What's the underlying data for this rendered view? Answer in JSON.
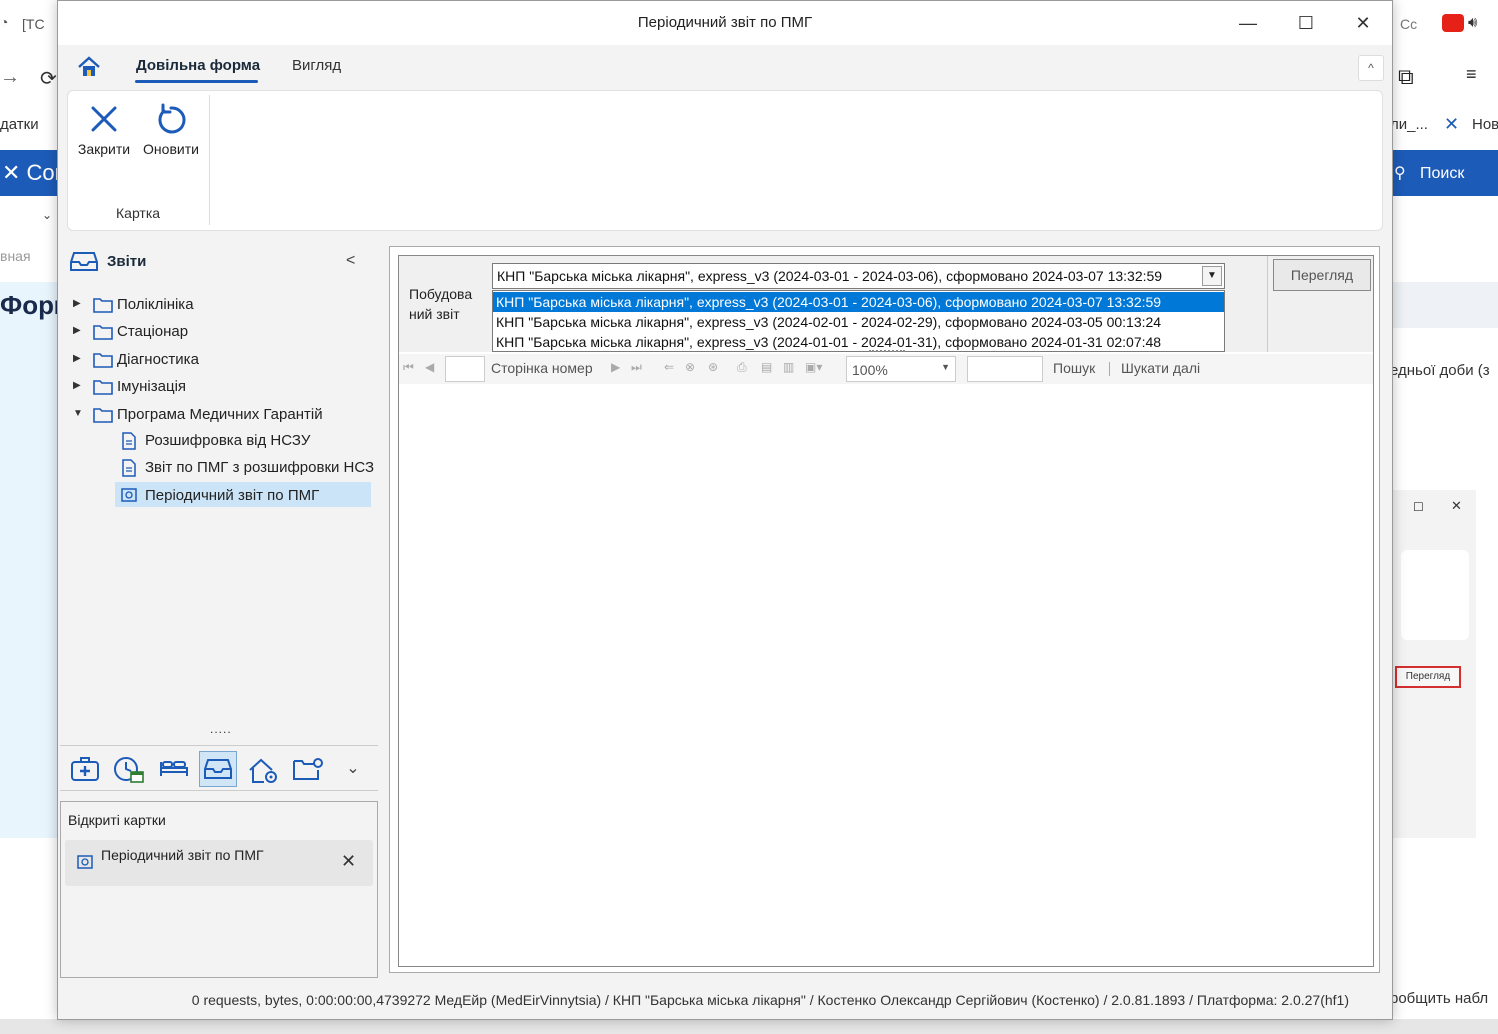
{
  "background": {
    "tab1": "[TC",
    "left_text1": "датки",
    "left_brand": "Con",
    "left_nav": "вная",
    "left_heading": "Форм",
    "right_tab": "Cc",
    "right_bookmark1": "ли_...",
    "right_bookmark2": "Нов",
    "right_search": "Поиск",
    "right_text1": "едньої доби  (з",
    "right_text2": "робщить набл",
    "right_view_button": "Перегляд"
  },
  "window": {
    "title": "Періодичний звіт по ПМГ",
    "minimize": "—",
    "maximize": "☐",
    "close": "✕"
  },
  "tabs": {
    "freeform": "Довільна форма",
    "view": "Вигляд",
    "collapse": "^"
  },
  "ribbon": {
    "close_label": "Закрити",
    "refresh_label": "Оновити",
    "group_label": "Картка"
  },
  "leftpanel": {
    "title": "Звіти",
    "collapse": "<",
    "tree": [
      {
        "label": "Поліклініка"
      },
      {
        "label": "Стаціонар"
      },
      {
        "label": "Діагностика"
      },
      {
        "label": "Імунізація"
      },
      {
        "label": "Програма Медичних Гарантій"
      }
    ],
    "leaves": [
      {
        "label": "Розшифровка від НСЗУ"
      },
      {
        "label": "Звіт по ПМГ з розшифровки НСЗ"
      },
      {
        "label": "Періодичний звіт по ПМГ"
      }
    ],
    "handle": ".....",
    "open_cards_title": "Відкриті картки",
    "open_card_label": "Періодичний звіт по ПМГ",
    "open_card_close": "✕"
  },
  "report": {
    "param_label": "Побудова ний звіт",
    "combo_value": "КНП \"Барська міська лікарня\", express_v3 (2024-03-01 - 2024-03-06), сформовано 2024-03-07 13:32:59",
    "options": [
      "КНП \"Барська міська лікарня\", express_v3 (2024-03-01 - 2024-03-06), сформовано 2024-03-07 13:32:59",
      "КНП \"Барська міська лікарня\", express_v3 (2024-02-01 - 2024-02-29), сформовано 2024-03-05 00:13:24",
      "КНП \"Барська міська лікарня\", express_v3 (2024-01-01 - 2024-01-31), сформовано 2024-01-31 02:07:48"
    ],
    "selected_option_index": 0,
    "view_button": "Перегляд",
    "toolbar": {
      "page_label": "Сторінка номер",
      "zoom": "100%",
      "search_label": "Пошук",
      "find_next_label": "Шукати далі"
    }
  },
  "status": {
    "text": "0 requests,  bytes, 0:00:00:00,4739272  МедЕйр (MedEirVinnytsia) / КНП \"Барська міська лікарня\" / Костенко Олександр Сергійович (Костенко) / 2.0.81.1893 / Платформа: 2.0.27(hf1)"
  },
  "colors": {
    "accent": "#1d5bb8",
    "selection": "#0078d7",
    "tree_selected": "#cce4f7"
  }
}
